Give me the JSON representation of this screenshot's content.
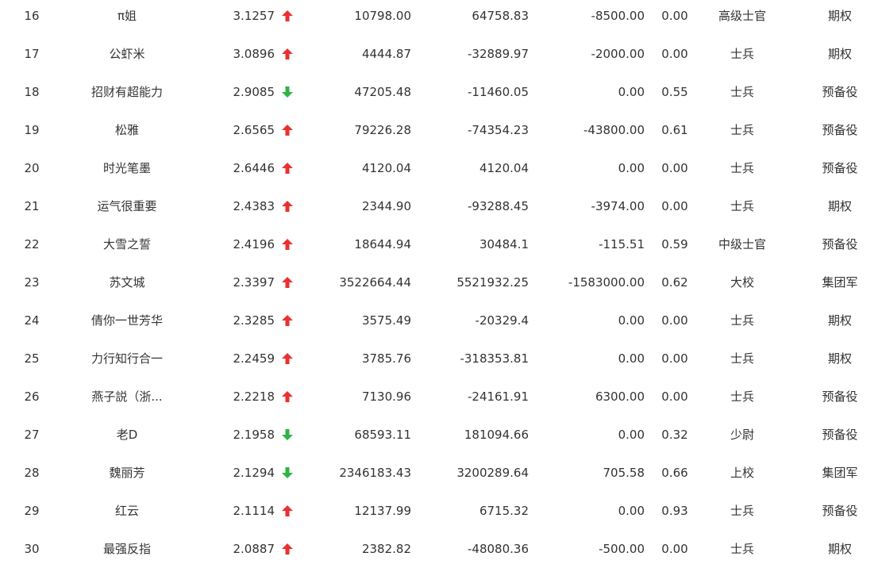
{
  "colors": {
    "up": "#e8322f",
    "down": "#2fb344",
    "text": "#333333"
  },
  "table": {
    "rows": [
      {
        "rank": "16",
        "name": "π姐",
        "score": "3.1257",
        "trend": "up",
        "v1": "10798.00",
        "v2": "64758.83",
        "v3": "-8500.00",
        "ratio": "0.00",
        "rank_name": "高级士官",
        "type": "期权"
      },
      {
        "rank": "17",
        "name": "公虾米",
        "score": "3.0896",
        "trend": "up",
        "v1": "4444.87",
        "v2": "-32889.97",
        "v3": "-2000.00",
        "ratio": "0.00",
        "rank_name": "士兵",
        "type": "期权"
      },
      {
        "rank": "18",
        "name": "招财有超能力",
        "score": "2.9085",
        "trend": "down",
        "v1": "47205.48",
        "v2": "-11460.05",
        "v3": "0.00",
        "ratio": "0.55",
        "rank_name": "士兵",
        "type": "预备役"
      },
      {
        "rank": "19",
        "name": "松雅",
        "score": "2.6565",
        "trend": "up",
        "v1": "79226.28",
        "v2": "-74354.23",
        "v3": "-43800.00",
        "ratio": "0.61",
        "rank_name": "士兵",
        "type": "预备役"
      },
      {
        "rank": "20",
        "name": "时光笔墨",
        "score": "2.6446",
        "trend": "up",
        "v1": "4120.04",
        "v2": "4120.04",
        "v3": "0.00",
        "ratio": "0.00",
        "rank_name": "士兵",
        "type": "预备役"
      },
      {
        "rank": "21",
        "name": "运气很重要",
        "score": "2.4383",
        "trend": "up",
        "v1": "2344.90",
        "v2": "-93288.45",
        "v3": "-3974.00",
        "ratio": "0.00",
        "rank_name": "士兵",
        "type": "期权"
      },
      {
        "rank": "22",
        "name": "大雪之誓",
        "score": "2.4196",
        "trend": "up",
        "v1": "18644.94",
        "v2": "30484.1",
        "v3": "-115.51",
        "ratio": "0.59",
        "rank_name": "中级士官",
        "type": "预备役"
      },
      {
        "rank": "23",
        "name": "苏文城",
        "score": "2.3397",
        "trend": "up",
        "v1": "3522664.44",
        "v2": "5521932.25",
        "v3": "-1583000.00",
        "ratio": "0.62",
        "rank_name": "大校",
        "type": "集团军"
      },
      {
        "rank": "24",
        "name": "倩你一世芳华",
        "score": "2.3285",
        "trend": "up",
        "v1": "3575.49",
        "v2": "-20329.4",
        "v3": "0.00",
        "ratio": "0.00",
        "rank_name": "士兵",
        "type": "期权"
      },
      {
        "rank": "25",
        "name": "力行知行合一",
        "score": "2.2459",
        "trend": "up",
        "v1": "3785.76",
        "v2": "-318353.81",
        "v3": "0.00",
        "ratio": "0.00",
        "rank_name": "士兵",
        "type": "期权"
      },
      {
        "rank": "26",
        "name": "燕子説（浙...",
        "score": "2.2218",
        "trend": "up",
        "v1": "7130.96",
        "v2": "-24161.91",
        "v3": "6300.00",
        "ratio": "0.00",
        "rank_name": "士兵",
        "type": "预备役"
      },
      {
        "rank": "27",
        "name": "老D",
        "score": "2.1958",
        "trend": "down",
        "v1": "68593.11",
        "v2": "181094.66",
        "v3": "0.00",
        "ratio": "0.32",
        "rank_name": "少尉",
        "type": "预备役"
      },
      {
        "rank": "28",
        "name": "魏丽芳",
        "score": "2.1294",
        "trend": "down",
        "v1": "2346183.43",
        "v2": "3200289.64",
        "v3": "705.58",
        "ratio": "0.66",
        "rank_name": "上校",
        "type": "集团军"
      },
      {
        "rank": "29",
        "name": "红云",
        "score": "2.1114",
        "trend": "up",
        "v1": "12137.99",
        "v2": "6715.32",
        "v3": "0.00",
        "ratio": "0.93",
        "rank_name": "士兵",
        "type": "预备役"
      },
      {
        "rank": "30",
        "name": "最强反指",
        "score": "2.0887",
        "trend": "up",
        "v1": "2382.82",
        "v2": "-48080.36",
        "v3": "-500.00",
        "ratio": "0.00",
        "rank_name": "士兵",
        "type": "期权"
      }
    ]
  }
}
